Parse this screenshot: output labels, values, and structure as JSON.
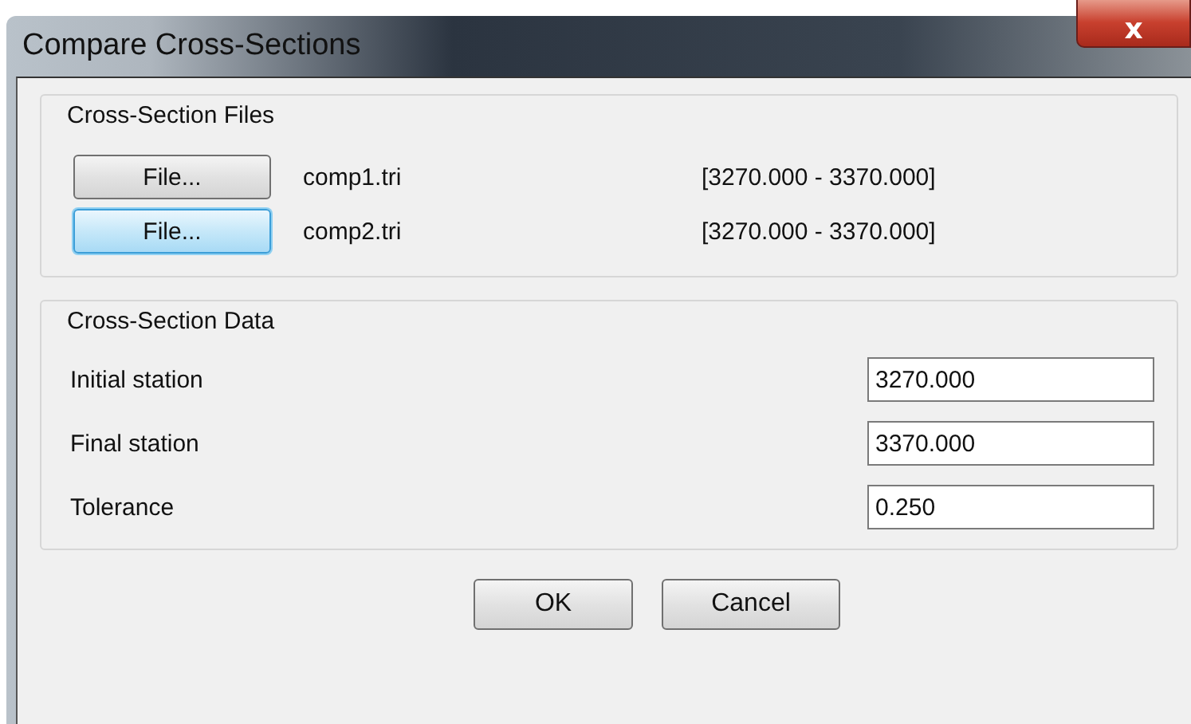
{
  "window": {
    "title": "Compare Cross-Sections",
    "close_label": "x"
  },
  "files_group": {
    "title": "Cross-Section Files",
    "rows": [
      {
        "button": "File...",
        "highlighted": false,
        "file": "comp1.tri",
        "range": "[3270.000 - 3370.000]"
      },
      {
        "button": "File...",
        "highlighted": true,
        "file": "comp2.tri",
        "range": "[3270.000 - 3370.000]"
      }
    ]
  },
  "data_group": {
    "title": "Cross-Section Data",
    "fields": [
      {
        "label": "Initial station",
        "value": "3270.000"
      },
      {
        "label": "Final station",
        "value": "3370.000"
      },
      {
        "label": "Tolerance",
        "value": "0.250"
      }
    ]
  },
  "buttons": [
    "OK",
    "Cancel"
  ]
}
